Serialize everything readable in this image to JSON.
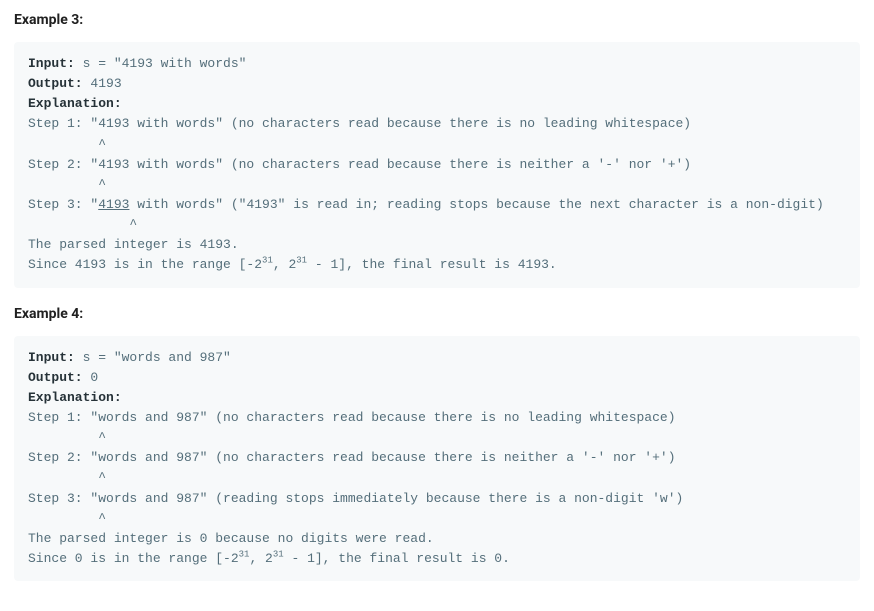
{
  "example3": {
    "title": "Example 3:",
    "input_label": "Input:",
    "input_val": " s = \"4193 with words\"",
    "output_label": "Output:",
    "output_val": " 4193",
    "explanation_label": "Explanation:",
    "step1_a": "Step 1: \"4193 with words\" (no characters read because there is no leading whitespace)",
    "caret1": "         ^",
    "step2_a": "Step 2: \"4193 with words\" (no characters read because there is neither a '-' nor '+')",
    "caret2": "         ^",
    "step3_pre": "Step 3: \"",
    "step3_underlined": "4193",
    "step3_post": " with words\" (\"4193\" is read in; reading stops because the next character is a non-digit)",
    "caret3": "             ^",
    "parsed": "The parsed integer is 4193.",
    "range_a": "Since 4193 is in the range [-2",
    "range_sup1": "31",
    "range_b": ", 2",
    "range_sup2": "31",
    "range_c": " - 1], the final result is 4193."
  },
  "example4": {
    "title": "Example 4:",
    "input_label": "Input:",
    "input_val": " s = \"words and 987\"",
    "output_label": "Output:",
    "output_val": " 0",
    "explanation_label": "Explanation:",
    "step1_a": "Step 1: \"words and 987\" (no characters read because there is no leading whitespace)",
    "caret1": "         ^",
    "step2_a": "Step 2: \"words and 987\" (no characters read because there is neither a '-' nor '+')",
    "caret2": "         ^",
    "step3_a": "Step 3: \"words and 987\" (reading stops immediately because there is a non-digit 'w')",
    "caret3": "         ^",
    "parsed": "The parsed integer is 0 because no digits were read.",
    "range_a": "Since 0 is in the range [-2",
    "range_sup1": "31",
    "range_b": ", 2",
    "range_sup2": "31",
    "range_c": " - 1], the final result is 0."
  }
}
